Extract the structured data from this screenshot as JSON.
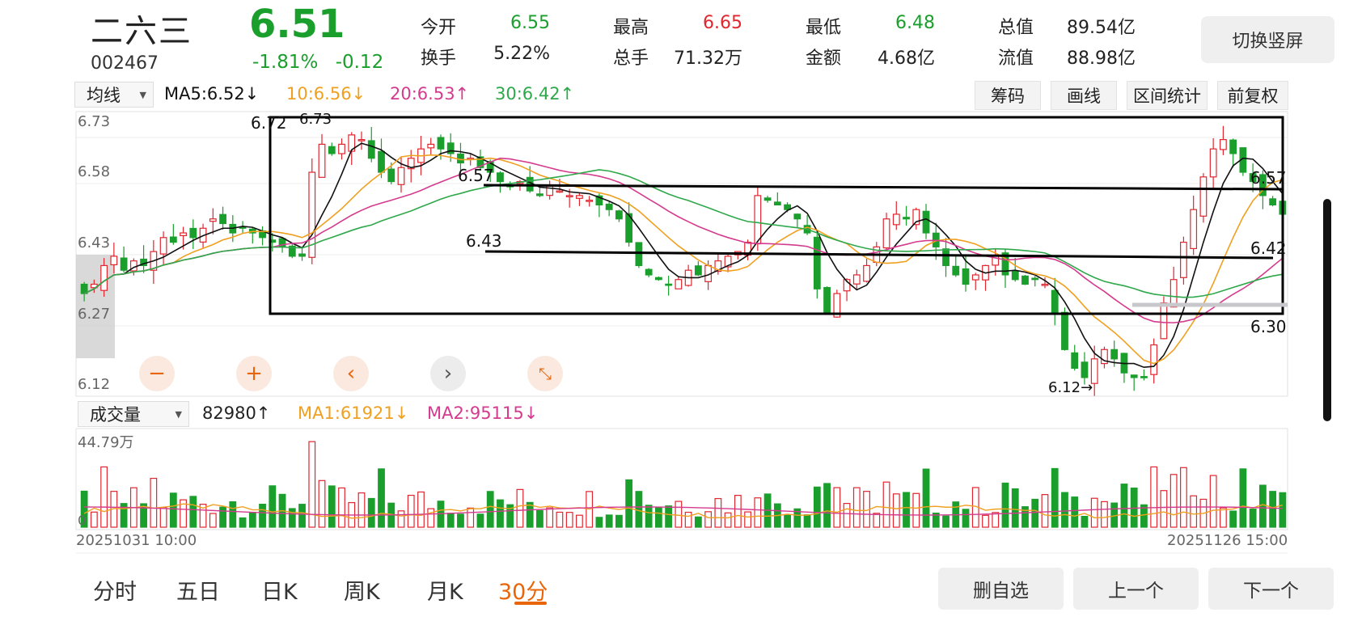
{
  "header": {
    "name": "二六三",
    "code": "002467",
    "price": "6.51",
    "change_pct": "-1.81%",
    "change_amt": "-0.12",
    "stats": [
      {
        "label": "今开",
        "value": "6.55",
        "color": "#1a9e2c"
      },
      {
        "label": "最高",
        "value": "6.65",
        "color": "#e0262f"
      },
      {
        "label": "最低",
        "value": "6.48",
        "color": "#1a9e2c"
      },
      {
        "label": "总值",
        "value": "89.54亿",
        "color": "#222222"
      },
      {
        "label": "换手",
        "value": "5.22%",
        "color": "#222222"
      },
      {
        "label": "总手",
        "value": "71.32万",
        "color": "#222222"
      },
      {
        "label": "金额",
        "value": "4.68亿",
        "color": "#222222"
      },
      {
        "label": "流值",
        "value": "88.98亿",
        "color": "#222222"
      }
    ],
    "switch_label": "切换竖屏"
  },
  "ma_bar": {
    "select_label": "均线",
    "ma5": "MA5:6.52↓",
    "ma10": "10:6.56↓",
    "ma20": "20:6.53↑",
    "ma30": "30:6.42↑"
  },
  "tools": [
    "筹码",
    "画线",
    "区间统计",
    "前复权"
  ],
  "price_axis": [
    "6.73",
    "6.58",
    "6.43",
    "6.27",
    "6.12"
  ],
  "annotations": {
    "peak_left": "6.72",
    "peak_left2": "6.73",
    "label_657_left": "6.57",
    "label_643": "6.43",
    "label_657_right": "6.57",
    "label_642": "6.42",
    "label_630": "6.30",
    "low_label": "6.12→"
  },
  "volume_bar": {
    "select_label": "成交量",
    "vol": "82980↑",
    "ma1": "MA1:61921↓",
    "ma2": "MA2:95115↓",
    "axis_top": "44.79万",
    "axis_zero": "0"
  },
  "time_axis": {
    "start": "20251031 10:00",
    "end": "20251126 15:00"
  },
  "period_tabs": [
    "分时",
    "五日",
    "日K",
    "周K",
    "月K",
    "30分"
  ],
  "active_tab": "30分",
  "bottom_buttons": [
    "删自选",
    "上一个",
    "下一个"
  ],
  "colors": {
    "up": "#e0262f",
    "down": "#1a9e2c",
    "ma5": "#111111",
    "ma10": "#f0a020",
    "ma20": "#d43b8e",
    "ma30": "#2ea84a",
    "accent": "#e8650a"
  },
  "chart_data": {
    "type": "candlestick",
    "interval": "30分",
    "ylim": [
      6.12,
      6.73
    ],
    "y_ticks": [
      6.73,
      6.58,
      6.43,
      6.27,
      6.12
    ],
    "closes": [
      6.34,
      6.36,
      6.4,
      6.42,
      6.39,
      6.41,
      6.4,
      6.43,
      6.46,
      6.45,
      6.47,
      6.46,
      6.48,
      6.5,
      6.49,
      6.47,
      6.48,
      6.47,
      6.46,
      6.45,
      6.44,
      6.42,
      6.42,
      6.6,
      6.66,
      6.64,
      6.66,
      6.68,
      6.67,
      6.63,
      6.6,
      6.58,
      6.61,
      6.63,
      6.65,
      6.66,
      6.65,
      6.64,
      6.62,
      6.63,
      6.61,
      6.6,
      6.58,
      6.57,
      6.58,
      6.56,
      6.55,
      6.57,
      6.56,
      6.55,
      6.55,
      6.54,
      6.53,
      6.52,
      6.5,
      6.45,
      6.4,
      6.38,
      6.37,
      6.36,
      6.37,
      6.39,
      6.38,
      6.4,
      6.41,
      6.42,
      6.43,
      6.45,
      6.55,
      6.54,
      6.53,
      6.52,
      6.5,
      6.47,
      6.35,
      6.3,
      6.34,
      6.37,
      6.38,
      6.4,
      6.44,
      6.5,
      6.51,
      6.5,
      6.52,
      6.47,
      6.44,
      6.4,
      6.38,
      6.36,
      6.38,
      6.4,
      6.42,
      6.38,
      6.37,
      6.36,
      6.37,
      6.36,
      6.3,
      6.22,
      6.18,
      6.16,
      6.2,
      6.22,
      6.2,
      6.17,
      6.16,
      6.16,
      6.23,
      6.32,
      6.37,
      6.45,
      6.52,
      6.59,
      6.65,
      6.67,
      6.64,
      6.6,
      6.58,
      6.55,
      6.53,
      6.51
    ],
    "ma_lines": [
      "MA5",
      "MA10",
      "MA20",
      "MA30"
    ]
  }
}
